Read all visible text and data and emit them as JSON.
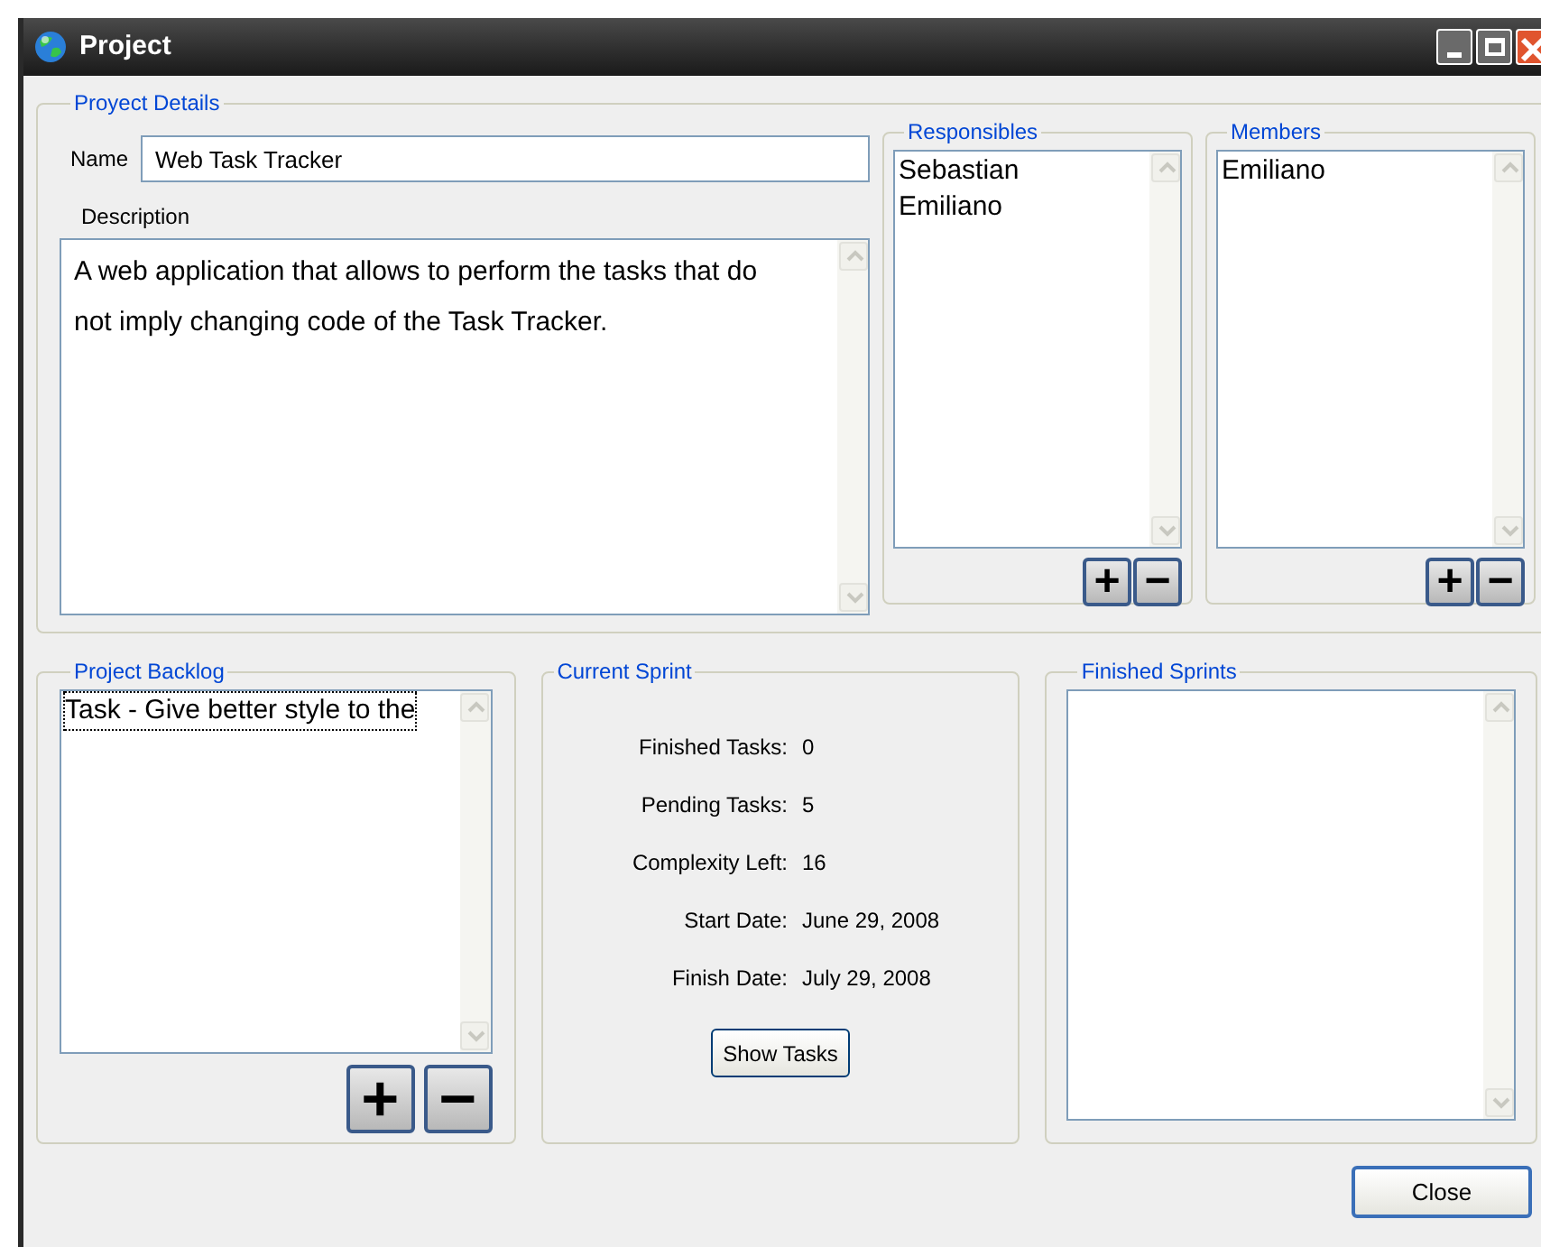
{
  "window": {
    "title": "Project"
  },
  "project_details": {
    "legend": "Proyect Details",
    "name_label": "Name",
    "name_value": "Web Task Tracker",
    "description_label": "Description",
    "description_value": "A web application that allows to perform the tasks that do not imply changing code of the Task Tracker.",
    "responsibles": {
      "legend": "Responsibles",
      "items": [
        {
          "label": "Sebastian",
          "selected": false
        },
        {
          "label": "Emiliano",
          "selected": false
        }
      ],
      "add": "+",
      "remove": "−"
    },
    "members": {
      "legend": "Members",
      "items": [
        {
          "label": "Emiliano",
          "selected": false
        }
      ],
      "add": "+",
      "remove": "−"
    }
  },
  "project_backlog": {
    "legend": "Project Backlog",
    "items": [
      {
        "label": "Task - Give better style to the",
        "selected": true
      }
    ],
    "add": "+",
    "remove": "−"
  },
  "current_sprint": {
    "legend": "Current Sprint",
    "fields": [
      {
        "label": "Finished Tasks:",
        "value": "0"
      },
      {
        "label": "Pending Tasks:",
        "value": "5"
      },
      {
        "label": "Complexity Left:",
        "value": "16"
      },
      {
        "label": "Start Date:",
        "value": "June 29, 2008"
      },
      {
        "label": "Finish Date:",
        "value": "July 29, 2008"
      }
    ],
    "button": "Show Tasks"
  },
  "finished_sprints": {
    "legend": "Finished Sprints"
  },
  "close_button": "Close"
}
